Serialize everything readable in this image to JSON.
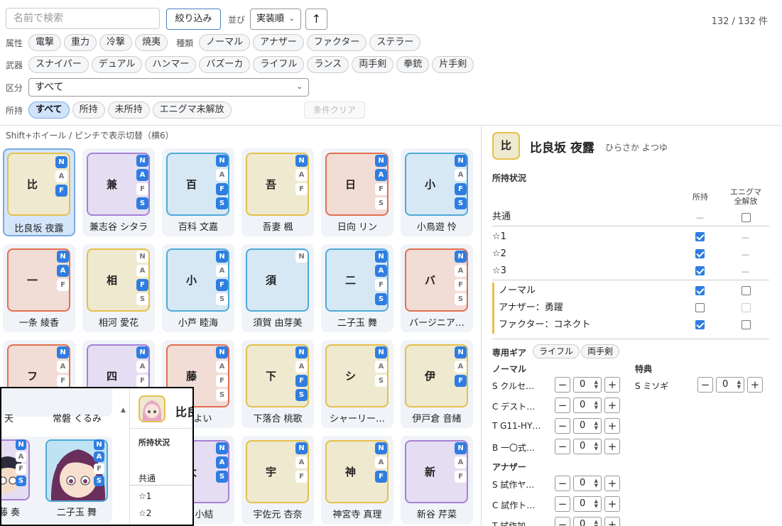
{
  "filters": {
    "search_placeholder": "名前で検索",
    "filter_button": "絞り込み",
    "sort_label": "並び",
    "sort_value": "実装順",
    "sort_dir": "↑",
    "count": "132 / 132 件",
    "attr_label": "属性",
    "attrs": [
      "電撃",
      "重力",
      "冷撃",
      "焼夷"
    ],
    "type_label": "種類",
    "types": [
      "ノーマル",
      "アナザー",
      "ファクター",
      "ステラー"
    ],
    "weapon_label": "武器",
    "weapons": [
      "スナイパー",
      "デュアル",
      "ハンマー",
      "バズーカ",
      "ライフル",
      "ランス",
      "両手剣",
      "拳銃",
      "片手剣"
    ],
    "category_label": "区分",
    "category_value": "すべて",
    "own_label": "所持",
    "own_options": [
      "すべて",
      "所持",
      "未所持",
      "エニグマ未解放"
    ],
    "clear_label": "条件クリア"
  },
  "hint": "Shift+ホイール / ピンチで表示切替（横6）",
  "cards": [
    {
      "char": "比",
      "name": "比良坂 夜露",
      "color": "#e5c04c",
      "bg": "#efe9cf",
      "badges": [
        "N",
        "A",
        "F"
      ],
      "on": [
        "N",
        "F"
      ]
    },
    {
      "char": "兼",
      "name": "兼志谷 シタラ",
      "color": "#a77fd6",
      "bg": "#e5def2",
      "badges": [
        "N",
        "A",
        "F",
        "S"
      ],
      "on": [
        "N",
        "A",
        "S"
      ]
    },
    {
      "char": "百",
      "name": "百科 文嘉",
      "color": "#4fa9d8",
      "bg": "#d6e8f3",
      "badges": [
        "N",
        "A",
        "F",
        "S"
      ],
      "on": [
        "N",
        "F",
        "S"
      ]
    },
    {
      "char": "吾",
      "name": "吾妻 楓",
      "color": "#e5c04c",
      "bg": "#efe9cf",
      "badges": [
        "N",
        "A",
        "F"
      ],
      "on": [
        "N"
      ]
    },
    {
      "char": "日",
      "name": "日向 リン",
      "color": "#e07050",
      "bg": "#f2dcd6",
      "badges": [
        "N",
        "A",
        "F",
        "S"
      ],
      "on": [
        "N",
        "A"
      ]
    },
    {
      "char": "小",
      "name": "小鳥遊 怜",
      "color": "#4fa9d8",
      "bg": "#d6e8f3",
      "badges": [
        "N",
        "A",
        "F",
        "S"
      ],
      "on": [
        "N",
        "F",
        "S"
      ]
    },
    {
      "char": "一",
      "name": "一条 綾香",
      "color": "#e07050",
      "bg": "#f2dcd6",
      "badges": [
        "N",
        "A",
        "F"
      ],
      "on": [
        "N",
        "A"
      ]
    },
    {
      "char": "相",
      "name": "相河 愛花",
      "color": "#e5c04c",
      "bg": "#efe9cf",
      "badges": [
        "N",
        "A",
        "F",
        "S"
      ],
      "on": [
        "F"
      ]
    },
    {
      "char": "小",
      "name": "小芦 睦海",
      "color": "#4fa9d8",
      "bg": "#d6e8f3",
      "badges": [
        "N",
        "A",
        "F",
        "S"
      ],
      "on": [
        "N",
        "F"
      ]
    },
    {
      "char": "須",
      "name": "須賀 由芽美",
      "color": "#4fa9d8",
      "bg": "#d6e8f3",
      "badges": [
        "N"
      ],
      "on": []
    },
    {
      "char": "二",
      "name": "二子玉 舞",
      "color": "#4fa9d8",
      "bg": "#d6e8f3",
      "badges": [
        "N",
        "A",
        "F",
        "S"
      ],
      "on": [
        "N",
        "A",
        "S"
      ]
    },
    {
      "char": "バ",
      "name": "バージニア…",
      "color": "#e07050",
      "bg": "#f2dcd6",
      "badges": [
        "N",
        "A",
        "F",
        "S"
      ],
      "on": [
        "N"
      ]
    },
    {
      "char": "フ",
      "name": "",
      "color": "#e07050",
      "bg": "#f2dcd6",
      "badges": [
        "N",
        "A",
        "F"
      ],
      "on": [
        "N"
      ]
    },
    {
      "char": "四",
      "name": "",
      "color": "#a77fd6",
      "bg": "#e5def2",
      "badges": [
        "N",
        "A",
        "F"
      ],
      "on": [
        "N"
      ]
    },
    {
      "char": "藤",
      "name": "やよい",
      "color": "#e07050",
      "bg": "#f2dcd6",
      "badges": [
        "N",
        "A",
        "F",
        "S"
      ],
      "on": [
        "N"
      ]
    },
    {
      "char": "下",
      "name": "下落合 桃歌",
      "color": "#e5c04c",
      "bg": "#efe9cf",
      "badges": [
        "N",
        "A",
        "F",
        "S"
      ],
      "on": [
        "N",
        "F",
        "S"
      ]
    },
    {
      "char": "シ",
      "name": "シャーリー…",
      "color": "#e5c04c",
      "bg": "#efe9cf",
      "badges": [
        "N",
        "A",
        "S"
      ],
      "on": [
        "N"
      ]
    },
    {
      "char": "伊",
      "name": "伊戸倉 音緒",
      "color": "#e5c04c",
      "bg": "#efe9cf",
      "badges": [
        "N",
        "A",
        "F"
      ],
      "on": [
        "N",
        "F"
      ]
    },
    {
      "char": "",
      "name": "",
      "color": "#4fa9d8",
      "bg": "#d6e8f3",
      "badges": [],
      "on": []
    },
    {
      "char": "",
      "name": "",
      "color": "#4fa9d8",
      "bg": "#d6e8f3",
      "badges": [],
      "on": []
    },
    {
      "char": "大",
      "name": "園 小結",
      "color": "#a77fd6",
      "bg": "#e5def2",
      "badges": [
        "N",
        "A",
        "S"
      ],
      "on": [
        "N",
        "A",
        "S"
      ]
    },
    {
      "char": "宇",
      "name": "宇佐元 杏奈",
      "color": "#e5c04c",
      "bg": "#efe9cf",
      "badges": [
        "N",
        "A",
        "F"
      ],
      "on": [
        "N"
      ]
    },
    {
      "char": "神",
      "name": "神宮寺 真理",
      "color": "#e5c04c",
      "bg": "#efe9cf",
      "badges": [
        "N",
        "A",
        "F"
      ],
      "on": [
        "N",
        "F"
      ]
    },
    {
      "char": "新",
      "name": "新谷 芹菜",
      "color": "#a77fd6",
      "bg": "#e5def2",
      "badges": [
        "N",
        "A",
        "F"
      ],
      "on": [
        "N"
      ]
    }
  ],
  "detail": {
    "char": "比",
    "name": "比良坂 夜露",
    "kana": "ひらさか よつゆ",
    "own_title": "所持状況",
    "col_own": "所持",
    "col_enigma_1": "エニグマ",
    "col_enigma_2": "全解放",
    "common": "共通",
    "dash": "—",
    "stars": [
      "☆1",
      "☆2",
      "☆3"
    ],
    "styles": [
      "ノーマル",
      "アナザー：勇躍",
      "ファクター：コネクト"
    ],
    "gear_title": "専用ギア",
    "gear_tags": [
      "ライフル",
      "両手剣"
    ],
    "normal_title": "ノーマル",
    "bonus_title": "特典",
    "another_title": "アナザー",
    "normal_gears": [
      "S クルセ…",
      "C デスト…",
      "T G11-HY…",
      "B 一〇式…"
    ],
    "bonus_gears": [
      "S ミソギ"
    ],
    "another_gears": [
      "S 試作ヤ…",
      "C 試作ト…",
      "T 試作加…"
    ],
    "zero": "0",
    "minus": "−",
    "plus": "+"
  },
  "overlay": {
    "name1": "天",
    "name2": "常磐 くるみ",
    "name3": "藤 奏",
    "name4": "二子玉 舞",
    "dname": "比良",
    "own_title": "所持状況",
    "common": "共通",
    "star1": "☆1",
    "star2": "☆2"
  }
}
